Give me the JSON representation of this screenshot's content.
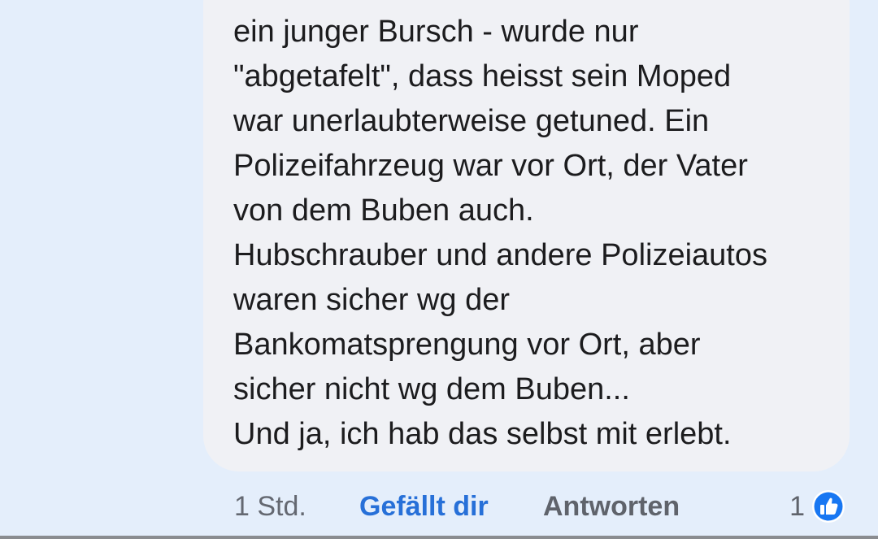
{
  "comment": {
    "lines": [
      "ein junger Bursch - wurde nur",
      "\"abgetafelt\", dass heisst sein Moped",
      "war unerlaubterweise getuned. Ein",
      "Polizeifahrzeug war vor Ort, der Vater",
      "von dem Buben auch.",
      "Hubschrauber und andere Polizeiautos",
      "waren sicher wg der",
      "Bankomatsprengung vor Ort, aber",
      "sicher nicht wg dem Buben...",
      "Und ja, ich hab das selbst mit erlebt."
    ]
  },
  "actions": {
    "timestamp": "1 Std.",
    "like_label": "Gefällt dir",
    "reply_label": "Antworten",
    "reaction_count": "1",
    "reaction_icon": "thumbs-up-icon"
  },
  "colors": {
    "background": "#e4eefb",
    "bubble": "#f0f1f5",
    "text": "#1c1c1e",
    "like_accent": "#2770d8",
    "muted": "#5f636b",
    "reaction_badge": "#1877f2"
  }
}
